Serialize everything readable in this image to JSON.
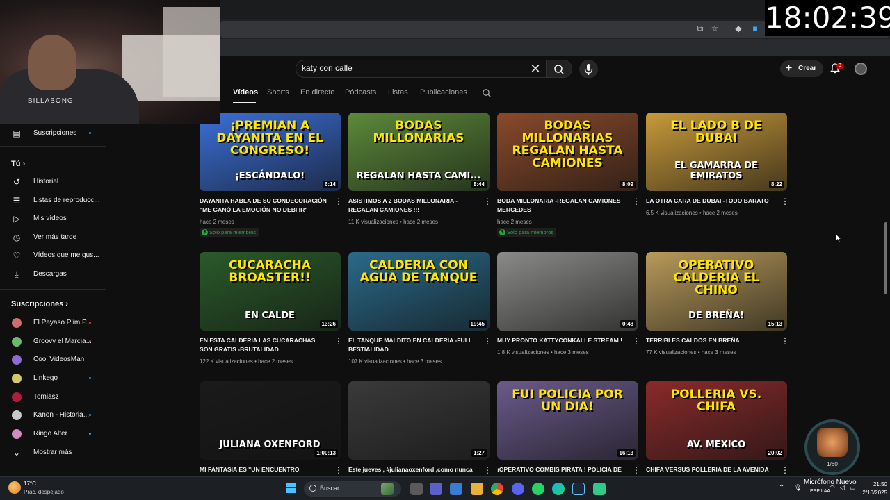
{
  "clock": "18:02:39",
  "webcam": {
    "shirt_text": "BILLABONG"
  },
  "search": {
    "value": "katy con calle"
  },
  "header": {
    "create_label": "Crear",
    "notifications_count": "3"
  },
  "channel_tabs": [
    {
      "label": "Vídeos",
      "active": true
    },
    {
      "label": "Shorts"
    },
    {
      "label": "En directo"
    },
    {
      "label": "Pódcasts"
    },
    {
      "label": "Listas"
    },
    {
      "label": "Publicaciones"
    }
  ],
  "sidebar": {
    "subscriptions_link": "Suscripciones",
    "you_heading": "Tú",
    "you_items": [
      {
        "label": "Historial",
        "icon": "history-icon"
      },
      {
        "label": "Listas de reproducc...",
        "icon": "playlist-icon"
      },
      {
        "label": "Mis vídeos",
        "icon": "my-videos-icon"
      },
      {
        "label": "Ver más tarde",
        "icon": "watch-later-icon"
      },
      {
        "label": "Vídeos que me gus...",
        "icon": "like-icon"
      },
      {
        "label": "Descargas",
        "icon": "download-icon"
      }
    ],
    "subs_heading": "Suscripciones",
    "subs": [
      {
        "label": "El Payaso Plim P...",
        "color": "#d06d6d",
        "live": true
      },
      {
        "label": "Groovy el Marcia...",
        "color": "#6db86d",
        "live": true
      },
      {
        "label": "Cool VideosMan",
        "color": "#8a6dd0",
        "live": false
      },
      {
        "label": "Linkego",
        "color": "#d0c86d",
        "live": true
      },
      {
        "label": "Tomiasz",
        "color": "#b01c3a",
        "live": false
      },
      {
        "label": "Kanon - Historia...",
        "color": "#c8c8c8",
        "live": true
      },
      {
        "label": "Ringo Alter",
        "color": "#d08ac0",
        "live": true
      }
    ],
    "show_more": "Mostrar más"
  },
  "videos": [
    {
      "title": "DAYANITA HABLA DE SU CONDECORACIÓN \"ME GANÓ LA EMOCIÓN NO DEBI IR\"",
      "meta": "hace 2 meses",
      "members": "Solo para miembros",
      "duration": "6:14",
      "cap1": "¡PREMIAN A DAYANITA EN EL CONGRESO!",
      "cap2": "¡ESCÁNDALO!",
      "bg": "#3b6fd8"
    },
    {
      "title": "ASISTIMOS A 2 BODAS MILLONARIA - REGALAN CAMIONES !!!",
      "meta": "11 K visualizaciones • hace 2 meses",
      "members": "",
      "duration": "8:44",
      "cap1": "BODAS MILLONARIAS",
      "cap2": "REGALAN HASTA CAMI...",
      "bg": "#5c8a3a"
    },
    {
      "title": "BODA MILLONARIA -REGALAN CAMIONES MERCEDES",
      "meta": "hace 2 meses",
      "members": "Solo para miembros",
      "duration": "8:09",
      "cap1": "BODAS MILLONARIAS REGALAN HASTA CAMIONES",
      "cap2": "",
      "bg": "#8a4a2a"
    },
    {
      "title": "LA OTRA CARA DE DUBAI -TODO BARATO",
      "meta": "6,5 K visualizaciones • hace 2 meses",
      "members": "",
      "duration": "8:22",
      "cap1": "EL LADO B DE DUBAI",
      "cap2": "EL GAMARRA DE EMIRATOS",
      "bg": "#c89a3a"
    },
    {
      "title": "EN ESTA CALDERIA LAS CUCARACHAS SON GRATIS -BRUTALIDAD",
      "meta": "122 K visualizaciones • hace 2 meses",
      "members": "",
      "duration": "13:26",
      "cap1": "CUCARACHA BROASTER!!",
      "cap2": "EN CALDE",
      "bg": "#2a5a2a"
    },
    {
      "title": "EL TANQUE MALDITO EN CALDERIA -FULL BESTIALIDAD",
      "meta": "107 K visualizaciones • hace 3 meses",
      "members": "",
      "duration": "19:45",
      "cap1": "CALDERIA CON AGUA DE TANQUE",
      "cap2": "",
      "bg": "#2a6a8a"
    },
    {
      "title": "MUY PRONTO KATTYCONKALLE STREAM !",
      "meta": "1,8 K visualizaciones • hace 3 meses",
      "members": "",
      "duration": "0:48",
      "cap1": "",
      "cap2": "",
      "bg": "#8a8a88"
    },
    {
      "title": "TERRIBLES CALDOS EN BREÑA",
      "meta": "77 K visualizaciones • hace 3 meses",
      "members": "",
      "duration": "15:13",
      "cap1": "OPERATIVO CALDERIA EL CHINO",
      "cap2": "DE BREÑA!",
      "bg": "#b89a5a"
    },
    {
      "title": "MI FANTASIA ES \"UN ENCUENTRO",
      "meta": "",
      "members": "",
      "duration": "1:00:13",
      "cap1": "",
      "cap2": "JULIANA OXENFORD",
      "bg": "#1a1a1a"
    },
    {
      "title": "Este jueves , #julianaoxenford ,como nunca",
      "meta": "",
      "members": "",
      "duration": "1:27",
      "cap1": "",
      "cap2": "",
      "bg": "#3a3a3a"
    },
    {
      "title": "¡OPERATIVO COMBIS PIRATA ! POLICIA DE",
      "meta": "",
      "members": "",
      "duration": "16:13",
      "cap1": "FUI POLICIA POR UN DIA!",
      "cap2": "",
      "bg": "#6a5a8a"
    },
    {
      "title": "CHIFA VERSUS POLLERIA DE LA AVENIDA",
      "meta": "",
      "members": "",
      "duration": "20:02",
      "cap1": "POLLERIA VS. CHIFA",
      "cap2": "AV. MEXICO",
      "bg": "#8a2a2a"
    }
  ],
  "widget": {
    "count": "1/60"
  },
  "taskbar": {
    "temp": "17°C",
    "weather": "Prac. despejado",
    "search_label": "Buscar",
    "mic_notice": "Micrófono Nuevo",
    "lang": "ESP LAA",
    "time": "21:50",
    "date": "2/10/2025"
  }
}
